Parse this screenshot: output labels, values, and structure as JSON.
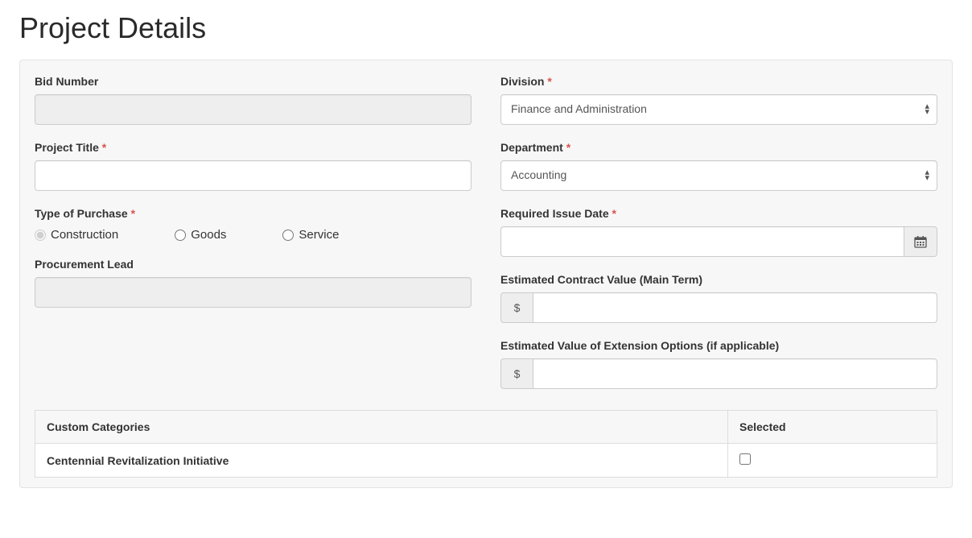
{
  "page_title": "Project Details",
  "left": {
    "bid_number": {
      "label": "Bid Number",
      "value": ""
    },
    "project_title": {
      "label": "Project Title",
      "required": "*",
      "value": ""
    },
    "type_of_purchase": {
      "label": "Type of Purchase",
      "required": "*",
      "options": [
        {
          "label": "Construction",
          "value": "construction",
          "checked": true
        },
        {
          "label": "Goods",
          "value": "goods",
          "checked": false
        },
        {
          "label": "Service",
          "value": "service",
          "checked": false
        }
      ]
    },
    "procurement_lead": {
      "label": "Procurement Lead",
      "value": ""
    }
  },
  "right": {
    "division": {
      "label": "Division",
      "required": "*",
      "selected": "Finance and Administration"
    },
    "department": {
      "label": "Department",
      "required": "*",
      "selected": "Accounting"
    },
    "required_issue_date": {
      "label": "Required Issue Date",
      "required": "*",
      "value": ""
    },
    "est_contract_value": {
      "label": "Estimated Contract Value (Main Term)",
      "currency": "$",
      "value": ""
    },
    "est_ext_value": {
      "label": "Estimated Value of Extension Options (if applicable)",
      "currency": "$",
      "value": ""
    }
  },
  "table": {
    "headers": {
      "col1": "Custom Categories",
      "col2": "Selected"
    },
    "rows": [
      {
        "name": "Centennial Revitalization Initiative",
        "selected": false
      }
    ]
  }
}
